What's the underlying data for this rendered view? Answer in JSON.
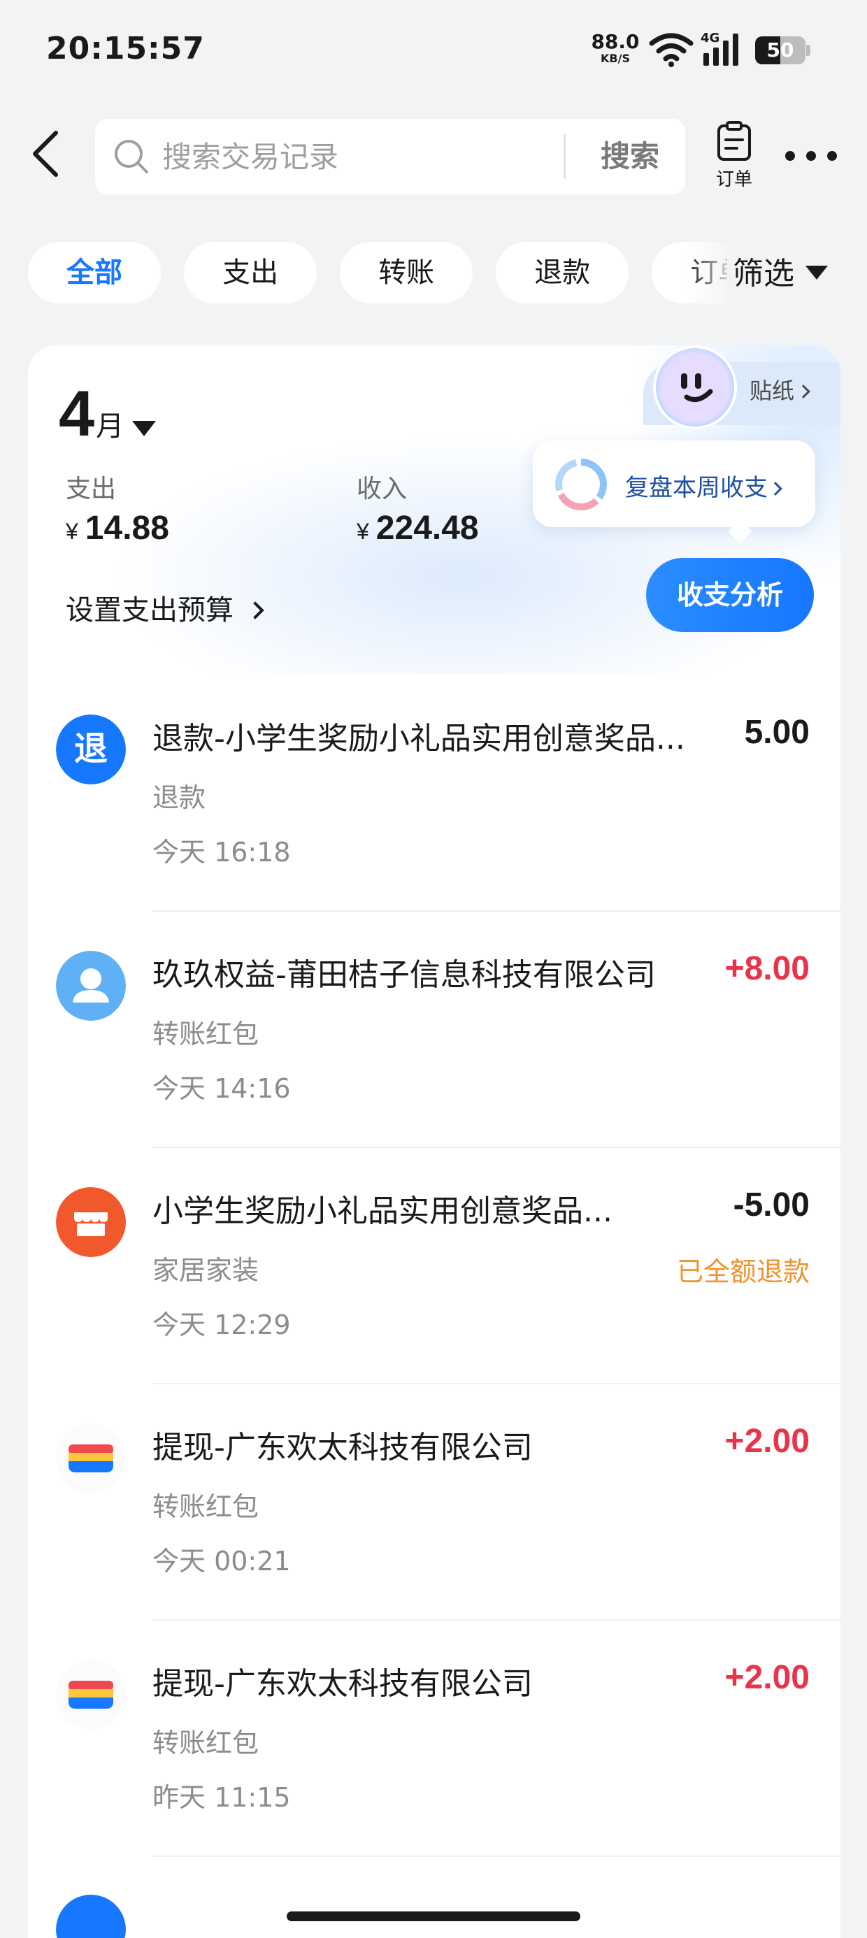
{
  "status_bar": {
    "time": "20:15:57",
    "net_speed_value": "88.0",
    "net_speed_unit": "KB/S",
    "network_type": "4G",
    "battery": "50",
    "battery_level": 0.5
  },
  "header": {
    "search_placeholder": "搜索交易记录",
    "search_button": "搜索",
    "orders_label": "订单"
  },
  "filters": {
    "chips": [
      "全部",
      "支出",
      "转账",
      "退款",
      "订单"
    ],
    "active_index": 0,
    "filter_button": "筛选"
  },
  "summary": {
    "month_number": "4",
    "month_unit": "月",
    "expense_label": "支出",
    "expense_value": "14.88",
    "income_label": "收入",
    "income_value": "224.48",
    "currency_symbol": "¥",
    "budget_link": "设置支出预算",
    "sticker_label": "贴纸",
    "weekly_review": "复盘本周收支",
    "analysis_button": "收支分析"
  },
  "transactions": [
    {
      "icon": "refund-icon",
      "icon_text": "退",
      "title": "退款-小学生奖励小礼品实用创意奖品...",
      "category": "退款",
      "time": "今天 16:18",
      "amount": "5.00",
      "amount_type": "neutral",
      "status": ""
    },
    {
      "icon": "user-avatar-icon",
      "title": "玖玖权益-莆田桔子信息科技有限公司",
      "category": "转账红包",
      "time": "今天 14:16",
      "amount": "+8.00",
      "amount_type": "positive",
      "status": ""
    },
    {
      "icon": "store-icon",
      "title": "小学生奖励小礼品实用创意奖品...",
      "category": "家居家装",
      "time": "今天 12:29",
      "amount": "-5.00",
      "amount_type": "neutral",
      "status": "已全额退款"
    },
    {
      "icon": "wallet-icon",
      "title": "提现-广东欢太科技有限公司",
      "category": "转账红包",
      "time": "今天 00:21",
      "amount": "+2.00",
      "amount_type": "positive",
      "status": ""
    },
    {
      "icon": "wallet-icon",
      "title": "提现-广东欢太科技有限公司",
      "category": "转账红包",
      "time": "昨天 11:15",
      "amount": "+2.00",
      "amount_type": "positive",
      "status": ""
    }
  ],
  "colors": {
    "accent": "#1677ff",
    "positive_amount": "#e8334a",
    "refund_status": "#f0922b",
    "page_background": "#f2f3f5"
  }
}
